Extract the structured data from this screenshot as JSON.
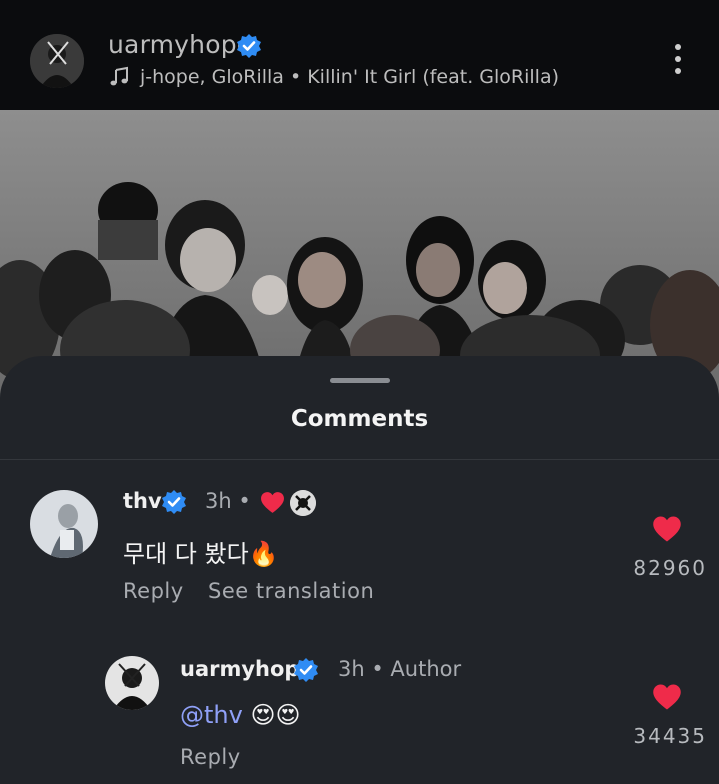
{
  "post": {
    "username": "uarmyhope",
    "music": "j-hope, GloRilla • Killin' It Girl (feat. GloRilla)"
  },
  "sheet": {
    "title": "Comments"
  },
  "comments": [
    {
      "username": "thv",
      "time": "3h •",
      "text": "무대 다 봤다🔥",
      "reply_label": "Reply",
      "translate_label": "See translation",
      "likes": "82960"
    },
    {
      "username": "uarmyhope",
      "time": "3h • Author",
      "mention": "@thv",
      "emoji": "😍😍",
      "reply_label": "Reply",
      "likes": "34435"
    }
  ],
  "colors": {
    "background": "#0b0c0e",
    "sheet": "#212429",
    "verified": "#2f8cf4",
    "heart": "#ef2b4a",
    "mention": "#8fa0f7"
  },
  "icons": [
    "music-note-icon",
    "verified-badge-icon",
    "more-options-icon",
    "heart-icon"
  ]
}
